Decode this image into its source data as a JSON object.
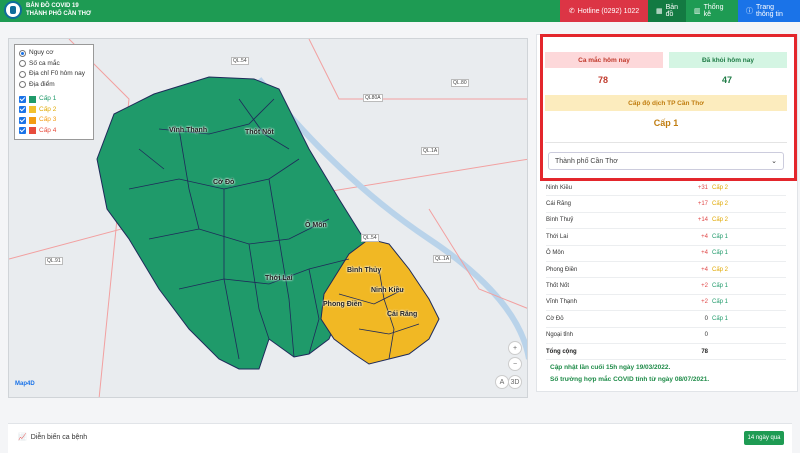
{
  "app": {
    "brand_line1": "BẢN ĐỒ COVID 19",
    "brand_line2": "THÀNH PHỐ CẦN THƠ"
  },
  "nav": {
    "hotline": "Hotline (0292) 1022",
    "map": "Bản đồ",
    "stats": "Thống kê",
    "info": "Trang thông tin"
  },
  "legend": {
    "radios": [
      "Nguy cơ",
      "Số ca mắc",
      "Địa chỉ F0 hôm nay",
      "Địa điểm"
    ],
    "selected_radio": "Nguy cơ",
    "levels": [
      {
        "label": "Cấp 1",
        "color": "#1f9a6a"
      },
      {
        "label": "Cấp 2",
        "color": "#f2c12e"
      },
      {
        "label": "Cấp 3",
        "color": "#f39c12"
      },
      {
        "label": "Cấp 4",
        "color": "#e74c3c"
      }
    ]
  },
  "map": {
    "places": [
      "Vĩnh Thạnh",
      "Thốt Nốt",
      "Cờ Đỏ",
      "Ô Môn",
      "Thới Lai",
      "Bình Thủy",
      "Ninh Kiều",
      "Phong Điền",
      "Cái Răng"
    ],
    "roads": [
      "QL.54",
      "QL80A",
      "QL.80",
      "QL.1A",
      "QL.91",
      "QL.54",
      "QL.1A"
    ],
    "attribution": "Map4D",
    "zoom_in": "+",
    "zoom_out": "−",
    "btn_a": "A",
    "btn_3d": "3D"
  },
  "stats": {
    "new_cases_label": "Ca mắc hôm nay",
    "new_cases_value": "78",
    "recovered_label": "Đã khỏi hôm nay",
    "recovered_value": "47",
    "level_label": "Cấp độ dịch TP Cần Thơ",
    "level_value": "Cấp 1",
    "select_value": "Thành phố Cần Thơ"
  },
  "table": {
    "rows": [
      {
        "name": "Ninh Kiều",
        "delta": "+31",
        "level": "Cấp 2"
      },
      {
        "name": "Cái Răng",
        "delta": "+17",
        "level": "Cấp 2"
      },
      {
        "name": "Bình Thuỷ",
        "delta": "+14",
        "level": "Cấp 2"
      },
      {
        "name": "Thới Lai",
        "delta": "+4",
        "level": "Cấp 1"
      },
      {
        "name": "Ô Môn",
        "delta": "+4",
        "level": "Cấp 1"
      },
      {
        "name": "Phong Điền",
        "delta": "+4",
        "level": "Cấp 2"
      },
      {
        "name": "Thốt Nốt",
        "delta": "+2",
        "level": "Cấp 1"
      },
      {
        "name": "Vĩnh Thạnh",
        "delta": "+2",
        "level": "Cấp 1"
      },
      {
        "name": "Cờ Đỏ",
        "delta": "0",
        "level": "Cấp 1"
      },
      {
        "name": "Ngoại tỉnh",
        "delta": "0",
        "level": ""
      }
    ],
    "total_label": "Tổng cộng",
    "total_value": "78"
  },
  "notes": {
    "update": "Cập nhật lần cuối 15h ngày 19/03/2022.",
    "since": "Số trường hợp mắc COVID tính từ ngày 08/07/2021."
  },
  "bottom": {
    "title": "Diễn biến ca bệnh",
    "days_button": "14 ngày qua"
  },
  "colors": {
    "green_zone": "#1f9a6a",
    "yellow_zone": "#f1b824",
    "border_dark": "#1e2a5a",
    "highlight_frame": "#e3262c"
  }
}
